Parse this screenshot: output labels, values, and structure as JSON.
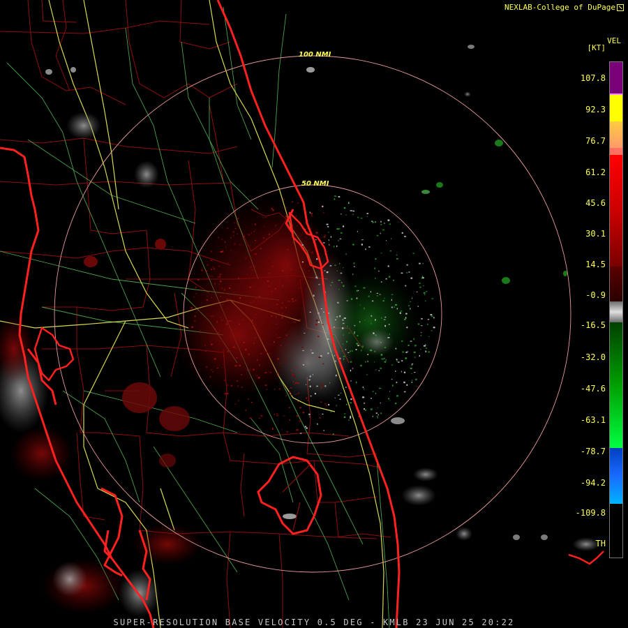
{
  "credit": "NEXLAB-College of DuPage",
  "footer": "SUPER-RESOLUTION BASE VELOCITY 0.5 DEG - KMLB 23 JUN 25 20:22",
  "rings": [
    "100 NMI",
    "50 NMI"
  ],
  "legend": {
    "variable": "VEL",
    "unit": "[KT]",
    "labels": [
      "107.8",
      "92.3",
      "76.7",
      "61.2",
      "45.6",
      "30.1",
      "14.5",
      "-0.9",
      "-16.5",
      "-32.0",
      "-47.6",
      "-63.1",
      "-78.7",
      "-94.2",
      "-109.8",
      "TH"
    ],
    "colors": {
      "purple": "#800080",
      "yellow": "#ffff00",
      "salmon": "#ff9a6a",
      "red": "#ff0000",
      "darkred": "#7a0000",
      "gray": "#9a9a9a",
      "green": "#00d000",
      "darkgreen": "#005a00",
      "blue": "#1a5aff",
      "cyan": "#00b4ff"
    }
  },
  "map_colors": {
    "coast": "#ff2020",
    "counties": "#b01010",
    "highways": "#d8d850",
    "roads": "#60c060",
    "rings": "#e89090"
  }
}
